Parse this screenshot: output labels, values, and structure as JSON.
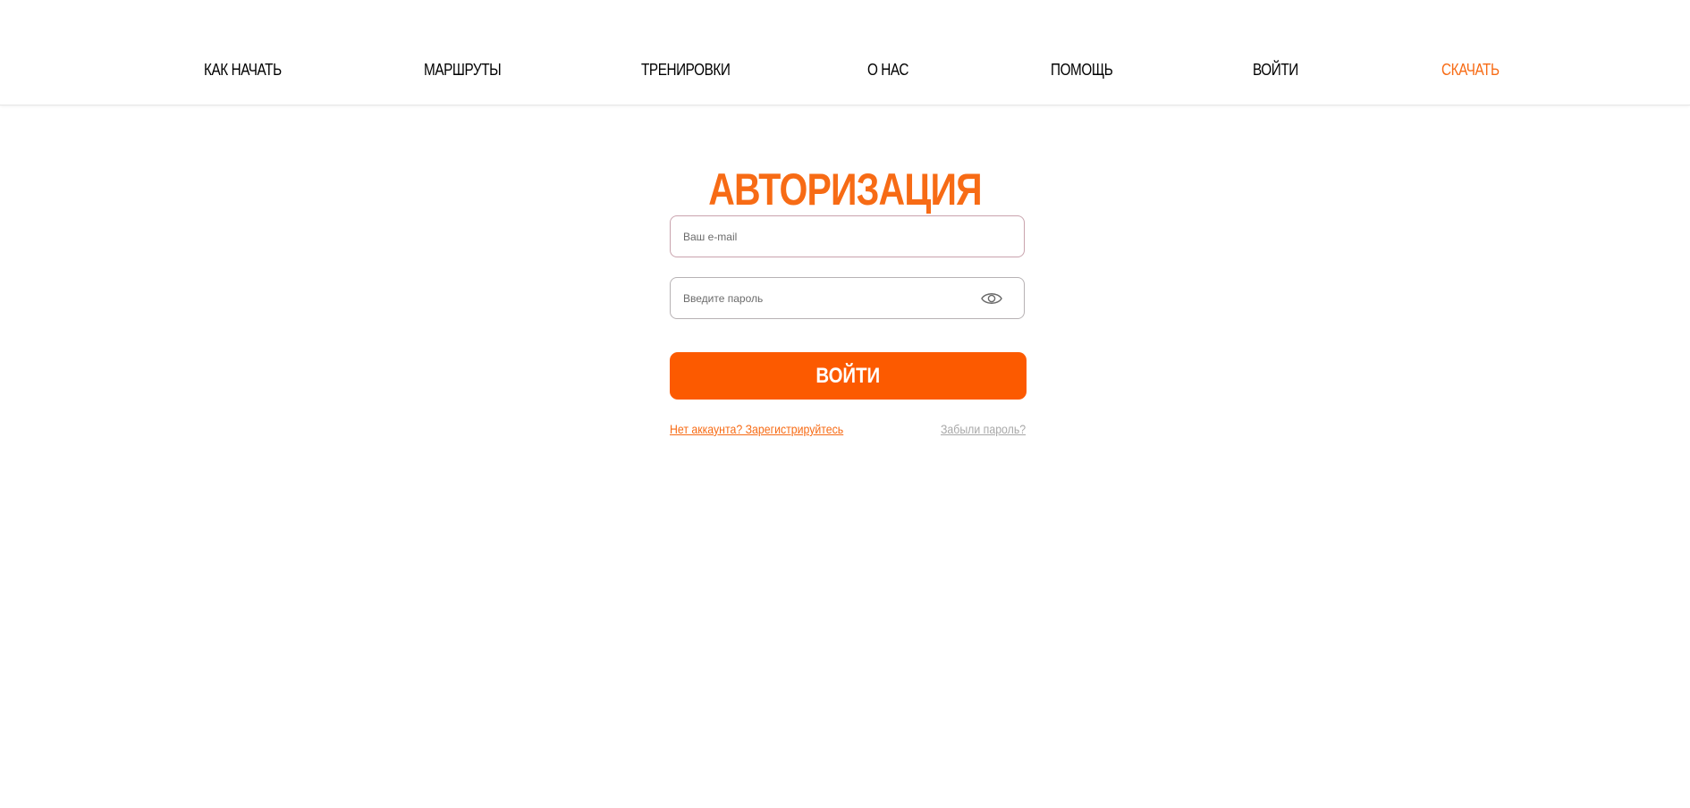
{
  "nav": {
    "items": [
      {
        "label": "КАК НАЧАТЬ"
      },
      {
        "label": "МАРШРУТЫ"
      },
      {
        "label": "ТРЕНИРОВКИ"
      },
      {
        "label": "О НАС"
      },
      {
        "label": "ПОМОЩЬ"
      },
      {
        "label": "ВОЙТИ"
      },
      {
        "label": "СКАЧАТЬ"
      }
    ]
  },
  "auth": {
    "title": "АВТОРИЗАЦИЯ",
    "email": {
      "value": "",
      "placeholder": "Ваш e-mail"
    },
    "password": {
      "value": "",
      "placeholder": "Введите пароль",
      "toggle_icon": "eye-icon"
    },
    "submit_label": "ВОЙТИ",
    "register_link": "Нет аккаунта? Зарегистрируйтесь",
    "forgot_link": "Забыли пароль?"
  },
  "colors": {
    "accent": "#f76b15",
    "button": "#fc5a00",
    "text": "#000000",
    "muted_link": "#a8a8a8"
  }
}
